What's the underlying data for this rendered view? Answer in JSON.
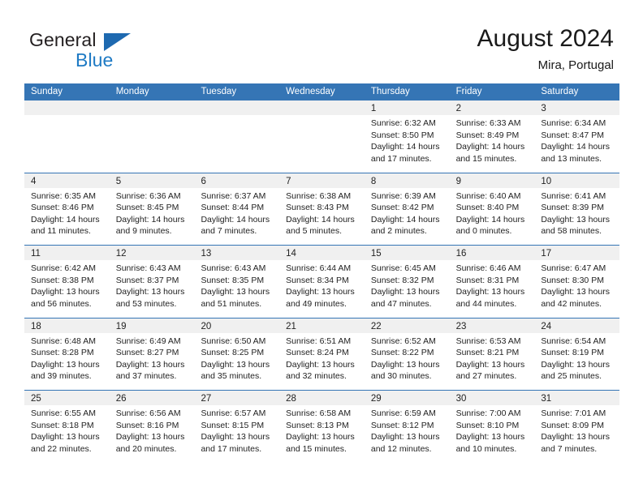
{
  "logo": {
    "word_top": "General",
    "word_bottom": "Blue",
    "triangle_icon": "blue-triangle-icon",
    "color_dark": "#231f20",
    "color_blue": "#1e7ac4"
  },
  "header": {
    "title": "August 2024",
    "subtitle": "Mira, Portugal"
  },
  "theme": {
    "header_blue": "#3575b5",
    "date_band_gray": "#f0f0f0",
    "text": "#222222"
  },
  "weekday_headers": [
    "Sunday",
    "Monday",
    "Tuesday",
    "Wednesday",
    "Thursday",
    "Friday",
    "Saturday"
  ],
  "weeks": [
    [
      {
        "date": "",
        "lines": []
      },
      {
        "date": "",
        "lines": []
      },
      {
        "date": "",
        "lines": []
      },
      {
        "date": "",
        "lines": []
      },
      {
        "date": "1",
        "lines": [
          "Sunrise: 6:32 AM",
          "Sunset: 8:50 PM",
          "Daylight: 14 hours",
          "and 17 minutes."
        ]
      },
      {
        "date": "2",
        "lines": [
          "Sunrise: 6:33 AM",
          "Sunset: 8:49 PM",
          "Daylight: 14 hours",
          "and 15 minutes."
        ]
      },
      {
        "date": "3",
        "lines": [
          "Sunrise: 6:34 AM",
          "Sunset: 8:47 PM",
          "Daylight: 14 hours",
          "and 13 minutes."
        ]
      }
    ],
    [
      {
        "date": "4",
        "lines": [
          "Sunrise: 6:35 AM",
          "Sunset: 8:46 PM",
          "Daylight: 14 hours",
          "and 11 minutes."
        ]
      },
      {
        "date": "5",
        "lines": [
          "Sunrise: 6:36 AM",
          "Sunset: 8:45 PM",
          "Daylight: 14 hours",
          "and 9 minutes."
        ]
      },
      {
        "date": "6",
        "lines": [
          "Sunrise: 6:37 AM",
          "Sunset: 8:44 PM",
          "Daylight: 14 hours",
          "and 7 minutes."
        ]
      },
      {
        "date": "7",
        "lines": [
          "Sunrise: 6:38 AM",
          "Sunset: 8:43 PM",
          "Daylight: 14 hours",
          "and 5 minutes."
        ]
      },
      {
        "date": "8",
        "lines": [
          "Sunrise: 6:39 AM",
          "Sunset: 8:42 PM",
          "Daylight: 14 hours",
          "and 2 minutes."
        ]
      },
      {
        "date": "9",
        "lines": [
          "Sunrise: 6:40 AM",
          "Sunset: 8:40 PM",
          "Daylight: 14 hours",
          "and 0 minutes."
        ]
      },
      {
        "date": "10",
        "lines": [
          "Sunrise: 6:41 AM",
          "Sunset: 8:39 PM",
          "Daylight: 13 hours",
          "and 58 minutes."
        ]
      }
    ],
    [
      {
        "date": "11",
        "lines": [
          "Sunrise: 6:42 AM",
          "Sunset: 8:38 PM",
          "Daylight: 13 hours",
          "and 56 minutes."
        ]
      },
      {
        "date": "12",
        "lines": [
          "Sunrise: 6:43 AM",
          "Sunset: 8:37 PM",
          "Daylight: 13 hours",
          "and 53 minutes."
        ]
      },
      {
        "date": "13",
        "lines": [
          "Sunrise: 6:43 AM",
          "Sunset: 8:35 PM",
          "Daylight: 13 hours",
          "and 51 minutes."
        ]
      },
      {
        "date": "14",
        "lines": [
          "Sunrise: 6:44 AM",
          "Sunset: 8:34 PM",
          "Daylight: 13 hours",
          "and 49 minutes."
        ]
      },
      {
        "date": "15",
        "lines": [
          "Sunrise: 6:45 AM",
          "Sunset: 8:32 PM",
          "Daylight: 13 hours",
          "and 47 minutes."
        ]
      },
      {
        "date": "16",
        "lines": [
          "Sunrise: 6:46 AM",
          "Sunset: 8:31 PM",
          "Daylight: 13 hours",
          "and 44 minutes."
        ]
      },
      {
        "date": "17",
        "lines": [
          "Sunrise: 6:47 AM",
          "Sunset: 8:30 PM",
          "Daylight: 13 hours",
          "and 42 minutes."
        ]
      }
    ],
    [
      {
        "date": "18",
        "lines": [
          "Sunrise: 6:48 AM",
          "Sunset: 8:28 PM",
          "Daylight: 13 hours",
          "and 39 minutes."
        ]
      },
      {
        "date": "19",
        "lines": [
          "Sunrise: 6:49 AM",
          "Sunset: 8:27 PM",
          "Daylight: 13 hours",
          "and 37 minutes."
        ]
      },
      {
        "date": "20",
        "lines": [
          "Sunrise: 6:50 AM",
          "Sunset: 8:25 PM",
          "Daylight: 13 hours",
          "and 35 minutes."
        ]
      },
      {
        "date": "21",
        "lines": [
          "Sunrise: 6:51 AM",
          "Sunset: 8:24 PM",
          "Daylight: 13 hours",
          "and 32 minutes."
        ]
      },
      {
        "date": "22",
        "lines": [
          "Sunrise: 6:52 AM",
          "Sunset: 8:22 PM",
          "Daylight: 13 hours",
          "and 30 minutes."
        ]
      },
      {
        "date": "23",
        "lines": [
          "Sunrise: 6:53 AM",
          "Sunset: 8:21 PM",
          "Daylight: 13 hours",
          "and 27 minutes."
        ]
      },
      {
        "date": "24",
        "lines": [
          "Sunrise: 6:54 AM",
          "Sunset: 8:19 PM",
          "Daylight: 13 hours",
          "and 25 minutes."
        ]
      }
    ],
    [
      {
        "date": "25",
        "lines": [
          "Sunrise: 6:55 AM",
          "Sunset: 8:18 PM",
          "Daylight: 13 hours",
          "and 22 minutes."
        ]
      },
      {
        "date": "26",
        "lines": [
          "Sunrise: 6:56 AM",
          "Sunset: 8:16 PM",
          "Daylight: 13 hours",
          "and 20 minutes."
        ]
      },
      {
        "date": "27",
        "lines": [
          "Sunrise: 6:57 AM",
          "Sunset: 8:15 PM",
          "Daylight: 13 hours",
          "and 17 minutes."
        ]
      },
      {
        "date": "28",
        "lines": [
          "Sunrise: 6:58 AM",
          "Sunset: 8:13 PM",
          "Daylight: 13 hours",
          "and 15 minutes."
        ]
      },
      {
        "date": "29",
        "lines": [
          "Sunrise: 6:59 AM",
          "Sunset: 8:12 PM",
          "Daylight: 13 hours",
          "and 12 minutes."
        ]
      },
      {
        "date": "30",
        "lines": [
          "Sunrise: 7:00 AM",
          "Sunset: 8:10 PM",
          "Daylight: 13 hours",
          "and 10 minutes."
        ]
      },
      {
        "date": "31",
        "lines": [
          "Sunrise: 7:01 AM",
          "Sunset: 8:09 PM",
          "Daylight: 13 hours",
          "and 7 minutes."
        ]
      }
    ]
  ]
}
